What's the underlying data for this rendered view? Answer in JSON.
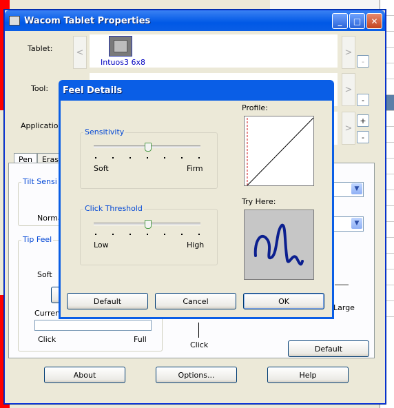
{
  "window": {
    "title": "Wacom Tablet Properties"
  },
  "rows": {
    "tablet_label": "Tablet:",
    "tool_label": "Tool:",
    "application_label": "Application:",
    "tablet_caption": "Intuos3 6x8"
  },
  "arrows": {
    "left": "<",
    "right": ">",
    "minus": "-",
    "plus": "+"
  },
  "tabs": [
    "Pen",
    "Eras"
  ],
  "pen_tab": {
    "tilt_label": "Tilt Sensi",
    "tilt_low": "Norma",
    "tip_feel_label": "Tip Feel",
    "tip_soft": "Soft",
    "current_label": "Current",
    "click_label": "Click",
    "full_label": "Full",
    "large_label": "Large",
    "click_bottom": "Click",
    "default_button": "Default"
  },
  "buttons": {
    "about": "About",
    "options": "Options...",
    "help": "Help"
  },
  "dialog": {
    "title": "Feel Details",
    "sensitivity": {
      "label": "Sensitivity",
      "min": "Soft",
      "max": "Firm",
      "value_fraction": 0.5
    },
    "click_threshold": {
      "label": "Click Threshold",
      "min": "Low",
      "max": "High",
      "value_fraction": 0.5
    },
    "profile_label": "Profile:",
    "try_here_label": "Try Here:",
    "default_button": "Default",
    "cancel_button": "Cancel",
    "ok_button": "OK"
  }
}
